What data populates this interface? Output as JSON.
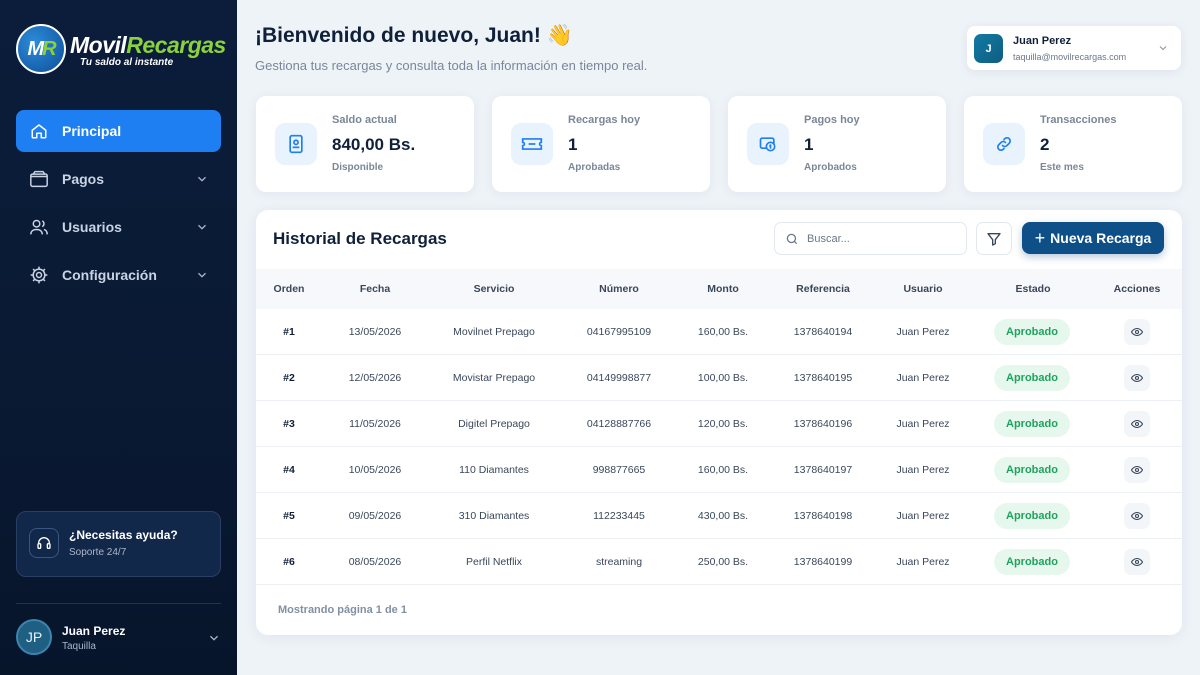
{
  "brand": {
    "name_main": "Movil",
    "name_accent": "Recargas",
    "tagline": "Tu saldo al instante",
    "mark_m": "M",
    "mark_r": "R"
  },
  "sidebar": {
    "items": [
      {
        "label": "Principal",
        "icon": "home-icon",
        "active": true
      },
      {
        "label": "Pagos",
        "icon": "wallet-icon"
      },
      {
        "label": "Usuarios",
        "icon": "users-icon"
      },
      {
        "label": "Configuración",
        "icon": "gear-icon"
      }
    ],
    "help": {
      "title": "¿Necesitas ayuda?",
      "subtitle": "Soporte 24/7"
    },
    "user": {
      "initials": "JP",
      "name": "Juan Perez",
      "role": "Taquilla"
    }
  },
  "header": {
    "welcome": "¡Bienvenido de nuevo, Juan! 👋",
    "subtitle": "Gestiona tus recargas y consulta toda la información en tiempo real.",
    "user": {
      "initial": "J",
      "name": "Juan Perez",
      "email": "taquilla@movilrecargas.com"
    }
  },
  "stats": [
    {
      "label": "Saldo actual",
      "value": "840,00 Bs.",
      "sub": "Disponible",
      "icon": "wallet-card-icon"
    },
    {
      "label": "Recargas hoy",
      "value": "1",
      "sub": "Aprobadas",
      "icon": "ticket-icon"
    },
    {
      "label": "Pagos hoy",
      "value": "1",
      "sub": "Aprobados",
      "icon": "money-icon"
    },
    {
      "label": "Transacciones",
      "value": "2",
      "sub": "Este mes",
      "icon": "link-icon"
    }
  ],
  "history": {
    "title": "Historial de Recargas",
    "search_placeholder": "Buscar...",
    "new_button": "Nueva Recarga",
    "columns": [
      "Orden",
      "Fecha",
      "Servicio",
      "Número",
      "Monto",
      "Referencia",
      "Usuario",
      "Estado",
      "Acciones"
    ],
    "rows": [
      {
        "orden": "#1",
        "fecha": "13/05/2026",
        "servicio": "Movilnet Prepago",
        "numero": "04167995109",
        "monto": "160,00 Bs.",
        "referencia": "1378640194",
        "usuario": "Juan Perez",
        "estado": "Aprobado"
      },
      {
        "orden": "#2",
        "fecha": "12/05/2026",
        "servicio": "Movistar Prepago",
        "numero": "04149998877",
        "monto": "100,00 Bs.",
        "referencia": "1378640195",
        "usuario": "Juan Perez",
        "estado": "Aprobado"
      },
      {
        "orden": "#3",
        "fecha": "11/05/2026",
        "servicio": "Digitel Prepago",
        "numero": "04128887766",
        "monto": "120,00 Bs.",
        "referencia": "1378640196",
        "usuario": "Juan Perez",
        "estado": "Aprobado"
      },
      {
        "orden": "#4",
        "fecha": "10/05/2026",
        "servicio": "110 Diamantes",
        "numero": "998877665",
        "monto": "160,00 Bs.",
        "referencia": "1378640197",
        "usuario": "Juan Perez",
        "estado": "Aprobado"
      },
      {
        "orden": "#5",
        "fecha": "09/05/2026",
        "servicio": "310 Diamantes",
        "numero": "112233445",
        "monto": "430,00 Bs.",
        "referencia": "1378640198",
        "usuario": "Juan Perez",
        "estado": "Aprobado"
      },
      {
        "orden": "#6",
        "fecha": "08/05/2026",
        "servicio": "Perfil Netflix",
        "numero": "streaming",
        "monto": "250,00 Bs.",
        "referencia": "1378640199",
        "usuario": "Juan Perez",
        "estado": "Aprobado"
      }
    ],
    "pagination": "Mostrando página 1 de 1"
  },
  "colors": {
    "primary": "#1e7ff2",
    "sidebar_bg": "#0b1d3b",
    "button_dark": "#0d4f86",
    "success": "#1fa35c",
    "brand_green": "#8ad13b"
  }
}
